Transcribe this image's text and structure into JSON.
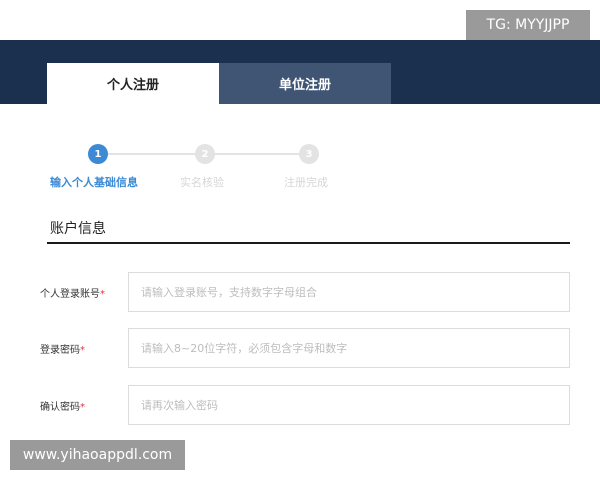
{
  "watermarks": {
    "top": "TG: MYYJJPP",
    "bottom": "www.yihaoappdl.com"
  },
  "tabs": [
    {
      "label": "个人注册",
      "active": true
    },
    {
      "label": "单位注册",
      "active": false
    }
  ],
  "steps": [
    {
      "number": "1",
      "label": "输入个人基础信息",
      "active": true
    },
    {
      "number": "2",
      "label": "实名核验",
      "active": false
    },
    {
      "number": "3",
      "label": "注册完成",
      "active": false
    }
  ],
  "section": {
    "title": "账户信息"
  },
  "form": {
    "fields": [
      {
        "label": "个人登录账号",
        "required_mark": "*",
        "value": "",
        "placeholder": "请输入登录账号，支持数字字母组合"
      },
      {
        "label": "登录密码",
        "required_mark": "*",
        "value": "",
        "placeholder": "请输入8~20位字符，必须包含字母和数字"
      },
      {
        "label": "确认密码",
        "required_mark": "*",
        "value": "",
        "placeholder": "请再次输入密码"
      }
    ]
  },
  "colors": {
    "header_bg": "#1b2f4e",
    "inactive_tab_bg": "#3f5573",
    "accent_blue": "#3c8ad6",
    "required_red": "#e0334a"
  }
}
